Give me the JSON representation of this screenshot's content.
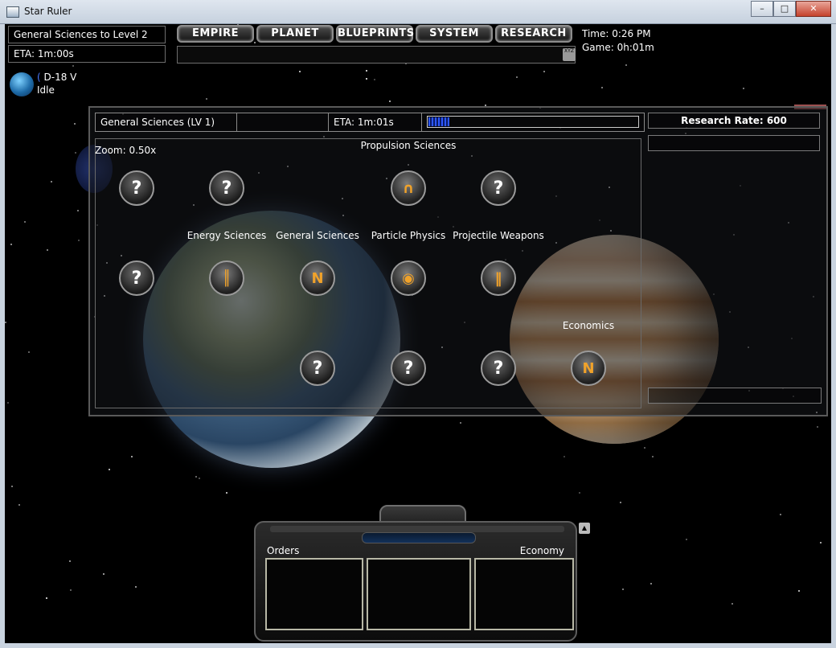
{
  "window": {
    "title": "Star Ruler",
    "minimize": "–",
    "maximize": "□",
    "close": "✕"
  },
  "queue": {
    "current": "General Sciences to Level 2",
    "eta": "ETA: 1m:00s"
  },
  "nav": {
    "empire": "EMPIRE",
    "planet": "PLANET",
    "blueprints": "BLUEPRINTS",
    "system": "SYSTEM",
    "research": "RESEARCH",
    "xyz": "XYZ"
  },
  "clock": {
    "time": "Time: 0:26 PM",
    "game": "Game: 0h:01m"
  },
  "selection": {
    "name": "D-18 V",
    "status": "Idle"
  },
  "research": {
    "current": "General Sciences (LV 1)",
    "eta": "ETA: 1m:01s",
    "progress": 0.1,
    "zoom": "Zoom: 0.50x",
    "rate": "Research Rate: 600",
    "nodes": [
      {
        "label": "",
        "known": false,
        "icon": "unknown-icon",
        "glyph": "?"
      },
      {
        "label": "",
        "known": false,
        "icon": "unknown-icon",
        "glyph": "?"
      },
      {
        "label": "Propulsion Sciences",
        "known": true,
        "icon": "propulsion-icon",
        "glyph": "∩"
      },
      {
        "label": "",
        "known": false,
        "icon": "unknown-icon",
        "glyph": "?"
      },
      {
        "label": "",
        "known": false,
        "icon": "unknown-icon",
        "glyph": "?"
      },
      {
        "label": "Energy Sciences",
        "known": true,
        "icon": "energy-icon",
        "glyph": "║"
      },
      {
        "label": "General Sciences",
        "known": true,
        "icon": "general-sciences-icon",
        "glyph": "N"
      },
      {
        "label": "Particle Physics",
        "known": true,
        "icon": "particle-physics-icon",
        "glyph": "◉"
      },
      {
        "label": "Projectile Weapons",
        "known": true,
        "icon": "projectile-weapons-icon",
        "glyph": "‖"
      },
      {
        "label": "",
        "known": false,
        "icon": "unknown-icon",
        "glyph": "?"
      },
      {
        "label": "",
        "known": false,
        "icon": "unknown-icon",
        "glyph": "?"
      },
      {
        "label": "",
        "known": false,
        "icon": "unknown-icon",
        "glyph": "?"
      },
      {
        "label": "Economics",
        "known": true,
        "icon": "economics-icon",
        "glyph": "N"
      }
    ]
  },
  "console": {
    "left_label": "Orders",
    "right_label": "Economy"
  }
}
